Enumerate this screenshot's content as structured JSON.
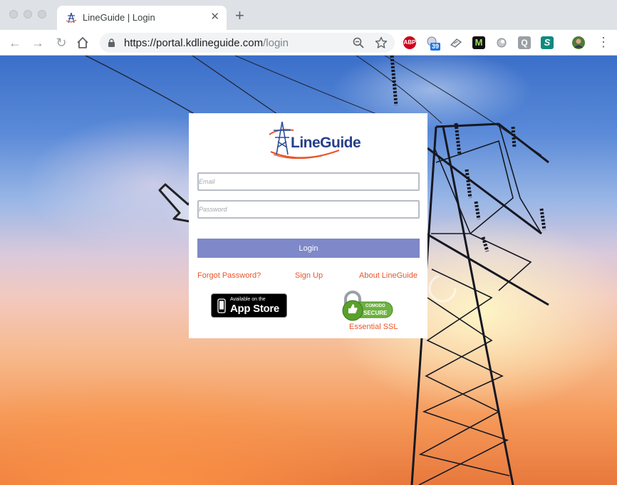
{
  "browser": {
    "tab": {
      "title": "LineGuide | Login",
      "close": "✕"
    },
    "new_tab": "+",
    "url_domain": "https://portal.kdlineguide.com",
    "url_path": "/login",
    "extensions": [
      {
        "name": "adblock-plus-icon",
        "label": "ABP",
        "color": "#d0021b"
      },
      {
        "name": "badge-extension-icon",
        "badge": "39",
        "color": "#1a73e8"
      },
      {
        "name": "paper-extension-icon",
        "color": "#7b8087"
      },
      {
        "name": "m-extension-icon",
        "label": "M",
        "color": "#5aa02c"
      },
      {
        "name": "circle-extension-icon",
        "color": "#9aa0a6"
      },
      {
        "name": "q-extension-icon",
        "label": "Q",
        "color": "#9aa0a6"
      },
      {
        "name": "s-extension-icon",
        "label": "S",
        "color": "#0f8a7e"
      }
    ],
    "menu": "⋮"
  },
  "login": {
    "brand": "LineGuide",
    "email_placeholder": "Email",
    "password_placeholder": "Password",
    "login_button": "Login",
    "links": {
      "forgot": "Forgot Password?",
      "signup": "Sign Up",
      "about": "About LineGuide"
    },
    "app_store": {
      "small": "Available on the",
      "big": "App Store"
    },
    "ssl": {
      "comodo_top": "COMODO",
      "comodo_bottom": "SECURE",
      "label": "Essential SSL"
    }
  },
  "colors": {
    "accent": "#e8562b",
    "button": "#7f88c8",
    "brand_blue": "#27408b"
  }
}
